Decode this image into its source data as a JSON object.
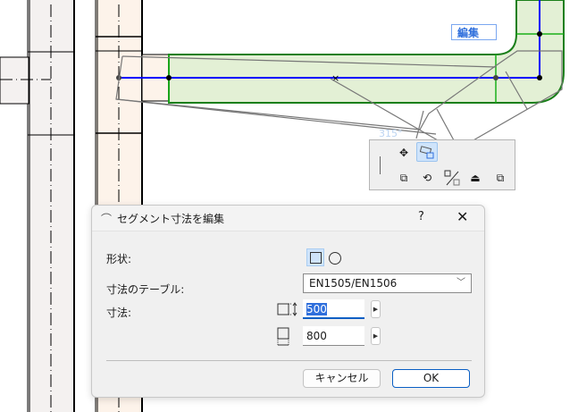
{
  "canvas": {
    "edit_tag": "編集",
    "angle_label": "315°"
  },
  "palette": {
    "tools": [
      "move-icon",
      "segment-edit-icon",
      "move-copy-icon",
      "rotate-icon",
      "mirror-icon",
      "elevate-icon",
      "multiply-icon"
    ]
  },
  "dialog": {
    "title": "セグメント寸法を編集",
    "help_label": "?",
    "close_label": "✕",
    "shape_label": "形状:",
    "table_label": "寸法のテーブル:",
    "table_value": "EN1505/EN1506",
    "size_label": "寸法:",
    "height_value": "500",
    "width_value": "800",
    "cancel_label": "キャンセル",
    "ok_label": "OK"
  },
  "colors": {
    "accent": "#2f6fdc",
    "duct_fill": "#e3f0d5",
    "duct_edge": "#1a9e1a",
    "centerline": "#0000ff"
  }
}
